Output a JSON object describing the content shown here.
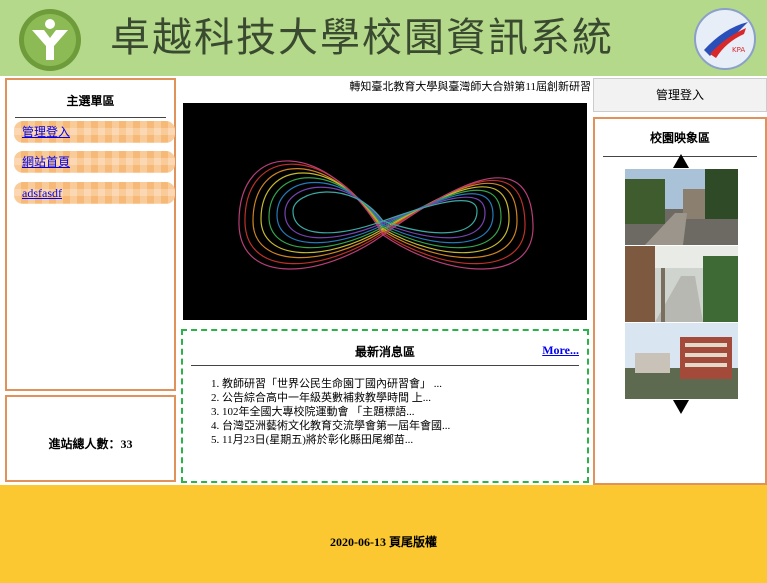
{
  "header": {
    "title": "卓越科技大學校園資訊系統",
    "left_logo_icon": "school-emblem-icon",
    "right_logo_icon": "arrow-globe-logo-icon",
    "right_logo_caption": "KPA"
  },
  "left_menu": {
    "title": "主選單區",
    "items": [
      {
        "label": "管理登入"
      },
      {
        "label": "網站首頁"
      },
      {
        "label": "adsfasdf"
      }
    ]
  },
  "counter": {
    "label": "進站總人數：33"
  },
  "marquee": {
    "text": "轉知臺北教育大學與臺灣師大合辦第11屆創新研習"
  },
  "news": {
    "title": "最新消息區",
    "more_label": "More...",
    "items": [
      "1. 教師研習「世界公民生命園丁國內研習會」 ...",
      "2. 公告綜合高中一年級英數補救教學時間 上...",
      "3. 102年全國大專校院運動會 「主題標語...",
      "4. 台灣亞洲藝術文化教育交流學會第一屆年會國...",
      "5. 11月23日(星期五)將於彰化縣田尾鄉苗..."
    ]
  },
  "right_panel": {
    "login_label": "管理登入",
    "gallery_title": "校園映象區",
    "up_icon": "triangle-up-icon",
    "down_icon": "triangle-down-icon"
  },
  "footer": {
    "text": "2020-06-13 頁尾版權"
  },
  "colors": {
    "header_bg": "#b5d98a",
    "panel_border": "#e0925a",
    "menu_item": "#f7b977",
    "news_border": "#2bb34a",
    "footer_bg": "#fbc831",
    "link": "#0000ee"
  }
}
